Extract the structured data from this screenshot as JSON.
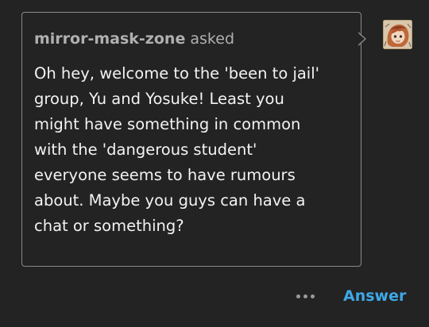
{
  "ask": {
    "asker_name": "mirror-mask-zone",
    "asked_label": "asked",
    "question_lines": [
      "Oh hey, welcome to the 'been to jail'",
      "group, Yu and Yosuke! Least you",
      "might have something in common",
      "with the 'dangerous student'",
      "everyone seems to have rumours",
      "about. Maybe you guys can have a",
      "chat or something?"
    ]
  },
  "avatar": {
    "icon": "asker-avatar-image"
  },
  "actions": {
    "more_icon": "more-dots-icon",
    "answer_label": "Answer"
  },
  "colors": {
    "background": "#232323",
    "bubble_border": "#8a8a8a",
    "asker_text": "#b0b0b0",
    "question_text": "#f3f3f3",
    "answer_accent": "#3ea8e6"
  }
}
